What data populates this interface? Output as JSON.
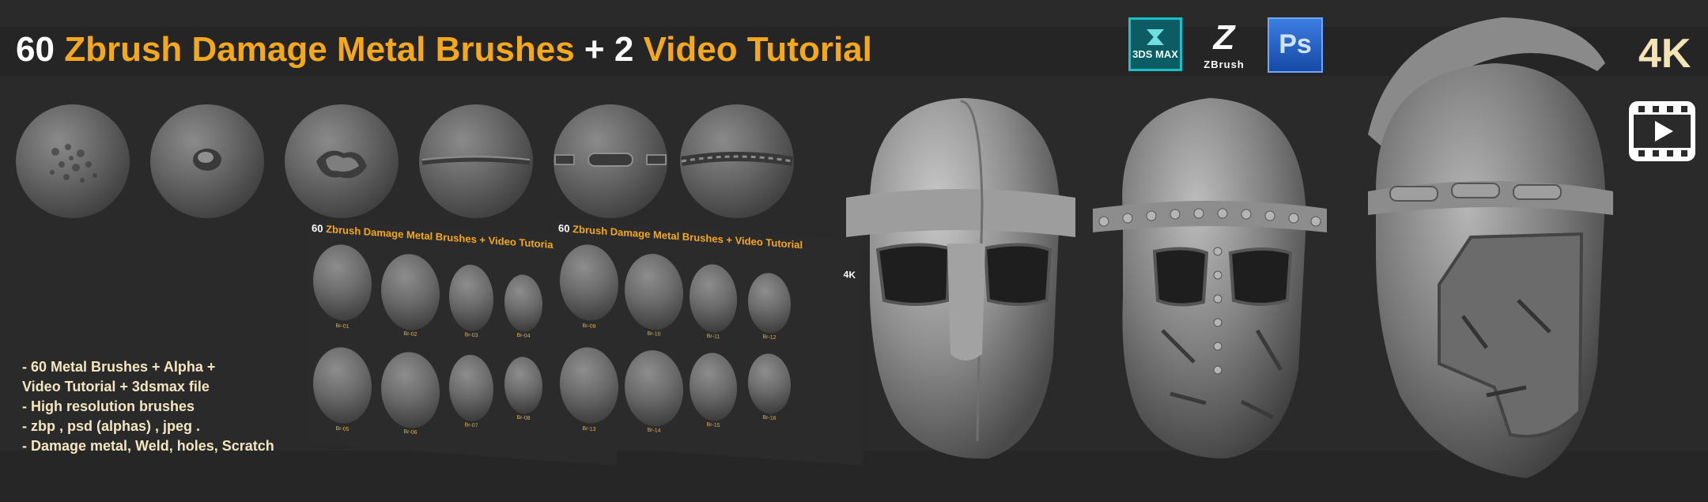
{
  "title": {
    "count1": "60",
    "text1": "Zbrush Damage Metal Brushes",
    "plus": "+",
    "count2": "2",
    "text2": "Video Tutorial"
  },
  "badge_4k": "4K",
  "logos": {
    "max_label": "3DS MAX",
    "zbrush_mark": "Z",
    "zbrush_label": "ZBrush",
    "ps_label": "Ps"
  },
  "panel1": {
    "title_num": "60",
    "title_text": "Zbrush Damage Metal Brushes + Video Tutorial",
    "badge": "4K",
    "labels": [
      "Br-01",
      "Br-02",
      "Br-03",
      "Br-04",
      "Br-05",
      "Br-06",
      "Br-07",
      "Br-08"
    ]
  },
  "panel2": {
    "title_num": "60",
    "title_text": "Zbrush Damage Metal Brushes + Video Tutorial",
    "badge": "4K",
    "labels": [
      "Br-09",
      "Br-10",
      "Br-11",
      "Br-12",
      "Br-13",
      "Br-14",
      "Br-15",
      "Br-16"
    ]
  },
  "features": [
    "- 60 Metal Brushes + Alpha +",
    "Video Tutorial + 3dsmax file",
    "- High resolution brushes",
    "- zbp , psd (alphas) , jpeg .",
    "- Damage metal, Weld, holes, Scratch"
  ],
  "icons": {
    "video": "video-icon"
  }
}
